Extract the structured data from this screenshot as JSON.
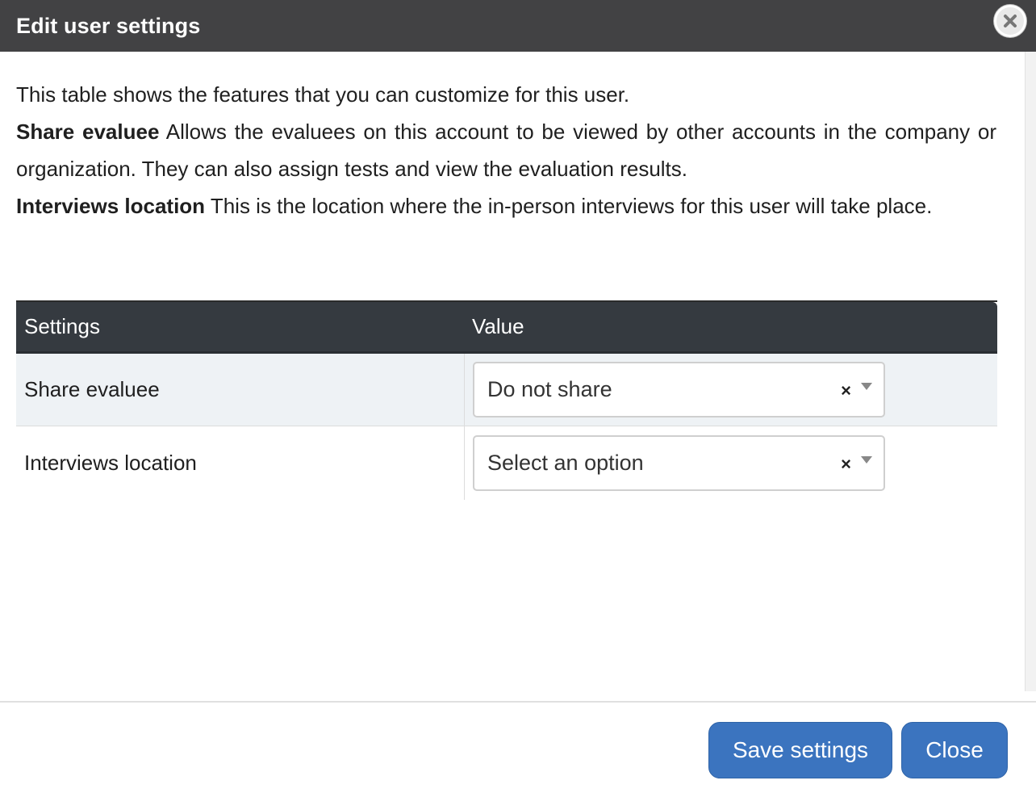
{
  "dialog": {
    "title": "Edit user settings",
    "close_icon": "close-icon"
  },
  "description": {
    "intro": "This table shows the features that you can customize for this user.",
    "share_term": "Share evaluee",
    "share_text": " Allows the evaluees on this account to be viewed by other accounts in the company or organization. They can also assign tests and view the evaluation results.",
    "location_term": "Interviews location",
    "location_text": " This is the location where the in-person interviews for this user will take place."
  },
  "table": {
    "headers": [
      "Settings",
      "Value"
    ],
    "rows": [
      {
        "setting": "Share evaluee",
        "value": "Do not share"
      },
      {
        "setting": "Interviews location",
        "value": "Select an option"
      }
    ],
    "clear_symbol": "×"
  },
  "footer": {
    "save_label": "Save settings",
    "close_label": "Close"
  },
  "colors": {
    "titlebar": "#424244",
    "table_header": "#353a40",
    "button": "#3b74bf",
    "striped_row": "#eef2f5"
  }
}
